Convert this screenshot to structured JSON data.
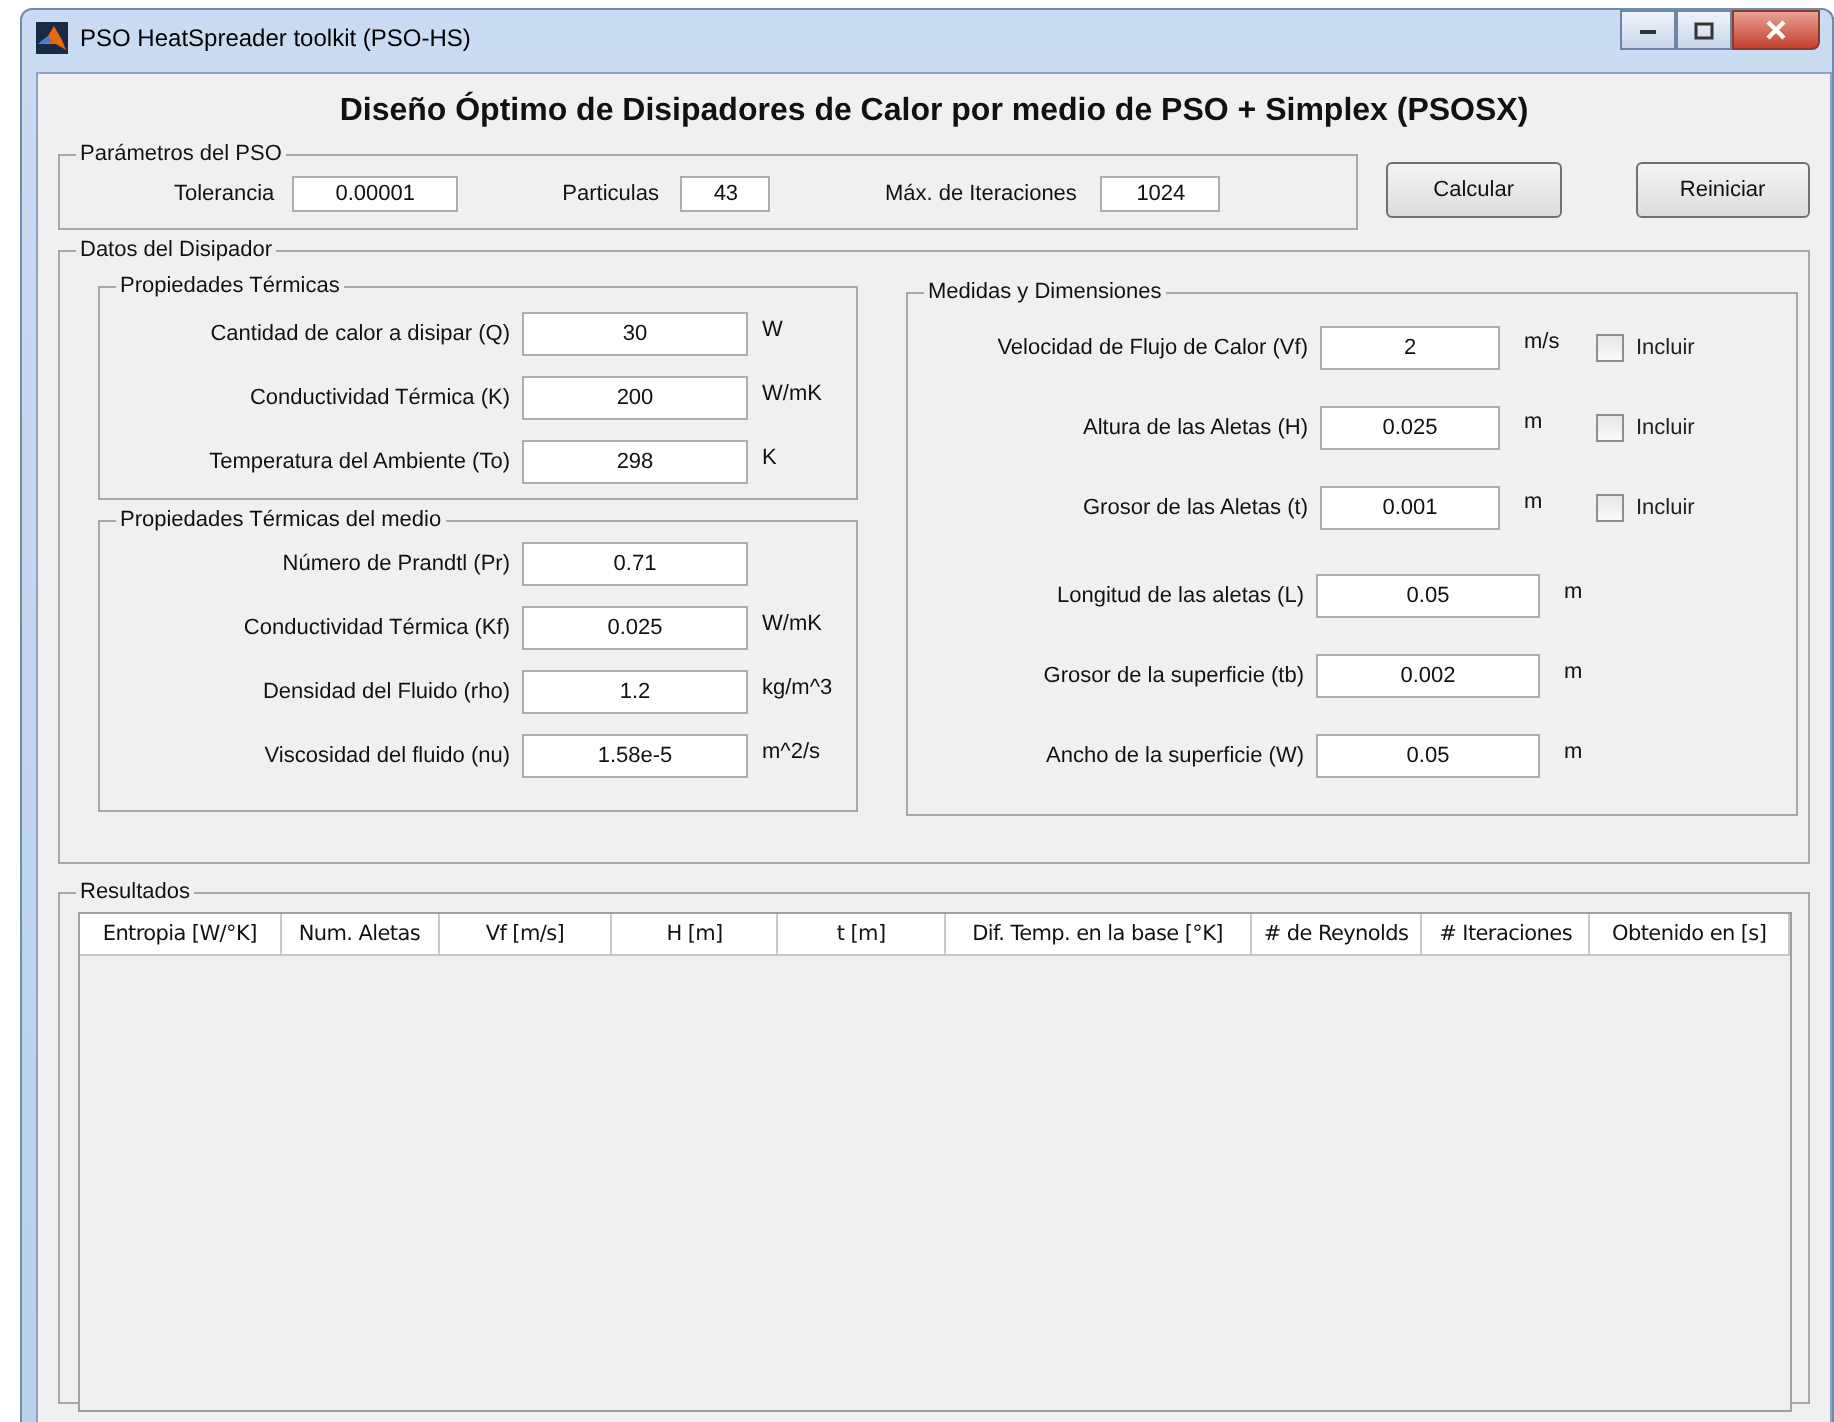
{
  "window": {
    "title": "PSO HeatSpreader toolkit (PSO-HS)"
  },
  "heading": "Diseño Óptimo de Disipadores de Calor por medio de PSO + Simplex (PSOSX)",
  "pso": {
    "legend": "Parámetros del PSO",
    "fields": [
      {
        "label": "Tolerancia",
        "value": "0.00001"
      },
      {
        "label": "Particulas",
        "value": "43"
      },
      {
        "label": "Máx. de Iteraciones",
        "value": "1024"
      }
    ]
  },
  "buttons": [
    "Calcular",
    "Reiniciar"
  ],
  "disipador": {
    "legend": "Datos del Disipador",
    "termicas": {
      "legend": "Propiedades Térmicas",
      "fields": [
        {
          "label": "Cantidad de calor a disipar (Q)",
          "value": "30",
          "unit": "W"
        },
        {
          "label": "Conductividad Térmica (K)",
          "value": "200",
          "unit": "W/mK"
        },
        {
          "label": "Temperatura del Ambiente (To)",
          "value": "298",
          "unit": "K"
        }
      ]
    },
    "medio": {
      "legend": "Propiedades Térmicas del medio",
      "fields": [
        {
          "label": "Número de Prandtl (Pr)",
          "value": "0.71"
        },
        {
          "label": "Conductividad Térmica (Kf)",
          "value": "0.025",
          "unit": "W/mK"
        },
        {
          "label": "Densidad del Fluido (rho)",
          "value": "1.2",
          "unit": "kg/m^3"
        },
        {
          "label": "Viscosidad del fluido (nu)",
          "value": "1.58e-5",
          "unit": "m^2/s"
        }
      ]
    },
    "medidas": {
      "legend": "Medidas y Dimensiones",
      "fields": [
        {
          "kind": "checkbox",
          "label": "Velocidad de Flujo de Calor (Vf)",
          "value": "2",
          "unit": "m/s",
          "option": "Incluir",
          "checked": false
        },
        {
          "kind": "checkbox",
          "label": "Altura de las Aletas (H)",
          "value": "0.025",
          "unit": "m",
          "option": "Incluir",
          "checked": false
        },
        {
          "kind": "checkbox",
          "label": "Grosor de las Aletas (t)",
          "value": "0.001",
          "unit": "m",
          "option": "Incluir",
          "checked": false
        },
        {
          "kind": "plain",
          "label": "Longitud de las aletas (L)",
          "value": "0.05",
          "unit": "m"
        },
        {
          "kind": "plain",
          "label": "Grosor de la superficie (tb)",
          "value": "0.002",
          "unit": "m"
        },
        {
          "kind": "plain",
          "label": "Ancho de la superficie (W)",
          "value": "0.05",
          "unit": "m"
        }
      ]
    }
  },
  "resultados": {
    "legend": "Resultados",
    "columns": [
      "Entropia [W/°K]",
      "Num. Aletas",
      "Vf [m/s]",
      "H [m]",
      "t [m]",
      "Dif. Temp. en la base [°K]",
      "# de Reynolds",
      "# Iteraciones",
      "Obtenido en [s]"
    ]
  }
}
